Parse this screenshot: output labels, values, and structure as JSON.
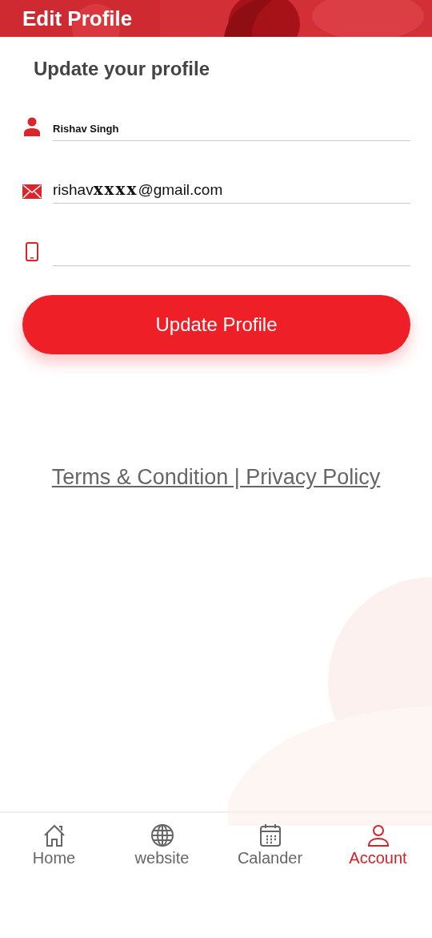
{
  "header": {
    "title": "Edit Profile"
  },
  "heading": "Update your profile",
  "fields": [
    {
      "kind": "name",
      "value": "Rishav Singh"
    },
    {
      "kind": "email",
      "value": "rishav**xxxx**@gmail.com"
    },
    {
      "kind": "phone"
    }
  ],
  "submit_button": "Update Profile",
  "footer_link": "Terms & Condition | Privacy Policy",
  "bottom_nav": [
    {
      "kind": "home",
      "label": "Home",
      "selected": false
    },
    {
      "kind": "globe",
      "label": "website",
      "selected": false
    },
    {
      "kind": "calendar",
      "label": "Calander",
      "selected": false
    },
    {
      "kind": "account",
      "label": "Account",
      "selected": true
    }
  ]
}
